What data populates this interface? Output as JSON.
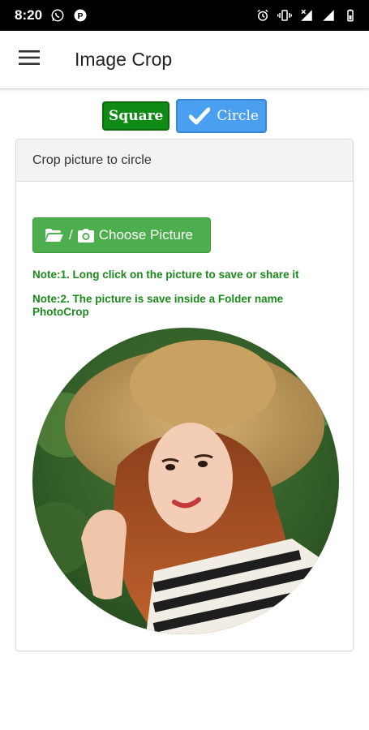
{
  "status_bar": {
    "time": "8:20",
    "left_icons": [
      "whatsapp-icon",
      "p-app-icon"
    ],
    "right_icons": [
      "alarm-icon",
      "vibrate-icon",
      "signal-icon",
      "signal-icon-2",
      "battery-icon"
    ]
  },
  "app_bar": {
    "title": "Image Crop",
    "menu_icon": "hamburger-menu-icon"
  },
  "mode_toggle": {
    "square_label": "Square",
    "circle_label": "Circle",
    "selected": "Circle",
    "square_color": "#0f8a14",
    "circle_color": "#4a9ff0"
  },
  "panel": {
    "heading": "Crop picture to circle",
    "choose_button": {
      "label": "Choose Picture",
      "separator": "/",
      "icons": [
        "folder-open-icon",
        "camera-icon"
      ],
      "color": "#4cae4c"
    },
    "note1": "Note:1. Long click on the picture to save or share it",
    "note2": "Note:2. The picture is save inside a Folder name PhotoCrop",
    "note_color": "#1a8a1a",
    "image": "circle-cropped-photo"
  }
}
